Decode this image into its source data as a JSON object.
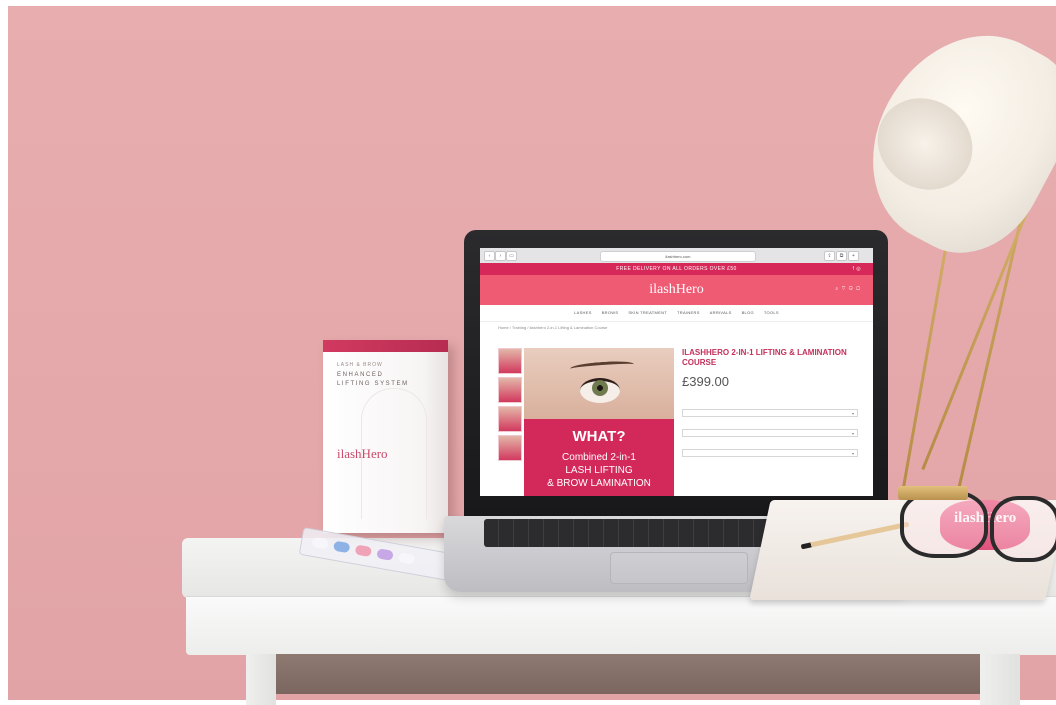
{
  "colors": {
    "wall": "#e6aaac",
    "brand_pink": "#f05b74",
    "brand_magenta": "#d6295a"
  },
  "product_box": {
    "subtitle": "LASH & BROW",
    "title_line1": "ENHANCED",
    "title_line2": "LIFTING SYSTEM",
    "logo": "ilashHero"
  },
  "browser": {
    "url": "ilashhero.com"
  },
  "site": {
    "promo": "FREE DELIVERY ON ALL ORDERS OVER £50",
    "logo": "ilashHero",
    "nav": [
      "LASHES",
      "BROWS",
      "SKIN TREATMENT",
      "TRAINERS",
      "ARRIVALS",
      "BLOG",
      "TOOLS"
    ],
    "breadcrumb": "Home / Training / ilashhero 2-in-1 Lifting & Lamination Course",
    "product_title": "ILASHHERO 2-IN-1 LIFTING & LAMINATION COURSE",
    "price": "£399.00",
    "hero_heading": "WHAT?",
    "hero_line1": "Combined 2-in-1",
    "hero_line2": "LASH LIFTING",
    "hero_line3": "& BROW LAMINATION"
  },
  "glasses_case": {
    "logo": "ilashHero"
  }
}
